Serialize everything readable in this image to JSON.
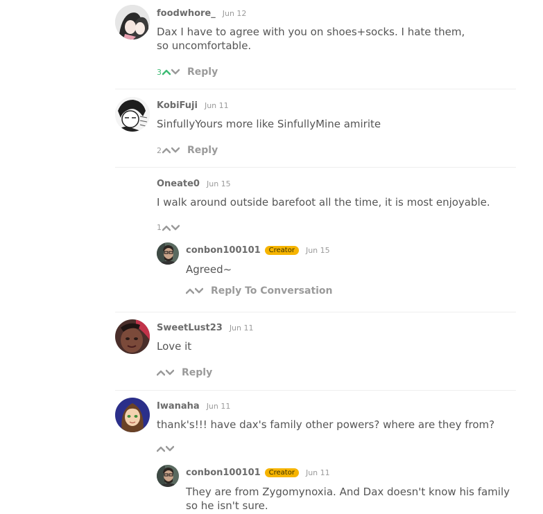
{
  "comments": [
    {
      "username": "foodwhore_",
      "date": "Jun 12",
      "text": "Dax I have to agree with you on shoes+socks. I hate them, so uncomfortable.",
      "votes": "3",
      "reply_label": "Reply",
      "avatar": "anime-couple-avatar"
    },
    {
      "username": "KobiFuji",
      "date": "Jun 11",
      "text": "SinfullyYours more like SinfullyMine amirite",
      "votes": "2",
      "reply_label": "Reply",
      "avatar": "manga-avatar"
    },
    {
      "username": "Oneate0",
      "date": "Jun 15",
      "text": "I walk around outside barefoot all the time, it is most enjoyable.",
      "votes": "1"
    },
    {
      "username": "conbon100101",
      "badge": "Creator",
      "date": "Jun 15",
      "text": "Agreed~",
      "reply_label": "Reply To Conversation",
      "avatar": "creator-avatar"
    },
    {
      "username": "SweetLust23",
      "date": "Jun 11",
      "text": "Love it",
      "reply_label": "Reply",
      "avatar": "photo-avatar"
    },
    {
      "username": "Iwanaha",
      "date": "Jun 11",
      "text": "thank's!!! have dax's family other powers? where are they from?",
      "avatar": "cartoon-girl-avatar"
    },
    {
      "username": "conbon100101",
      "badge": "Creator",
      "date": "Jun 11",
      "text": "They are from Zygomynoxia. And Dax doesn't know his family so he isn't sure.",
      "avatar": "creator-avatar"
    }
  ],
  "colors": {
    "upvote_active": "#3dbb74",
    "creator_badge": "#f6b400",
    "muted_text": "#9a9a9a"
  }
}
